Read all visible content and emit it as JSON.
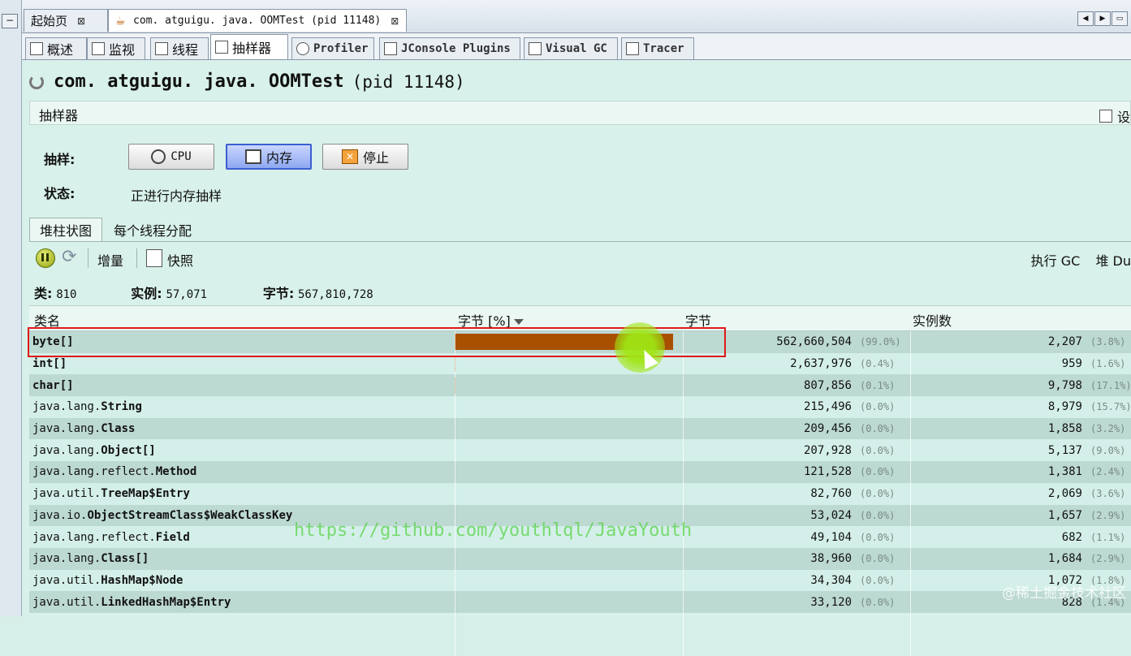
{
  "doc_tabs": [
    {
      "label": "起始页",
      "close": "⊠"
    },
    {
      "label": "com. atguigu. java. OOMTest  (pid 11148)",
      "close": "⊠"
    }
  ],
  "view_tabs": [
    "概述",
    "监视",
    "线程",
    "抽样器",
    "Profiler",
    "JConsole Plugins",
    "Visual GC",
    "Tracer"
  ],
  "app": {
    "title": "com. atguigu. java. OOMTest",
    "pid": "(pid 11148)"
  },
  "section": {
    "label": "抽样器",
    "settings": "设"
  },
  "sampler": {
    "sample_label": "抽样:",
    "cpu": "CPU",
    "memory": "内存",
    "stop": "停止",
    "status_label": "状态:",
    "status_value": "正进行内存抽样"
  },
  "sub_tabs": [
    "堆柱状图",
    "每个线程分配"
  ],
  "toolbar": {
    "delta": "增量",
    "snapshot": "快照",
    "gc": "执行 GC",
    "heap_dump": "堆 Du"
  },
  "summary": {
    "classes_label": "类:",
    "classes": "810",
    "instances_label": "实例:",
    "instances": "57,071",
    "bytes_label": "字节:",
    "bytes": "567,810,728"
  },
  "columns": {
    "name": "类名",
    "bytes_pct": "字节 [%]",
    "bytes": "字节",
    "instances": "实例数"
  },
  "rows": [
    {
      "name_plain": "",
      "name_bold": "byte[]",
      "bytes": "562,660,504",
      "bytes_pct": "(99.0%)",
      "instances": "2,207",
      "inst_pct": "(3.8%)",
      "fraction": 0.99
    },
    {
      "name_plain": "",
      "name_bold": "int[]",
      "bytes": "2,637,976",
      "bytes_pct": "(0.4%)",
      "instances": "959",
      "inst_pct": "(1.6%)",
      "fraction": 0.004
    },
    {
      "name_plain": "",
      "name_bold": "char[]",
      "bytes": "807,856",
      "bytes_pct": "(0.1%)",
      "instances": "9,798",
      "inst_pct": "(17.1%)",
      "fraction": 0.001
    },
    {
      "name_plain": "java.lang.",
      "name_bold": "String",
      "bytes": "215,496",
      "bytes_pct": "(0.0%)",
      "instances": "8,979",
      "inst_pct": "(15.7%)",
      "fraction": 0
    },
    {
      "name_plain": "java.lang.",
      "name_bold": "Class",
      "bytes": "209,456",
      "bytes_pct": "(0.0%)",
      "instances": "1,858",
      "inst_pct": "(3.2%)",
      "fraction": 0
    },
    {
      "name_plain": "java.lang.",
      "name_bold": "Object[]",
      "bytes": "207,928",
      "bytes_pct": "(0.0%)",
      "instances": "5,137",
      "inst_pct": "(9.0%)",
      "fraction": 0
    },
    {
      "name_plain": "java.lang.reflect.",
      "name_bold": "Method",
      "bytes": "121,528",
      "bytes_pct": "(0.0%)",
      "instances": "1,381",
      "inst_pct": "(2.4%)",
      "fraction": 0
    },
    {
      "name_plain": "java.util.",
      "name_bold": "TreeMap$Entry",
      "bytes": "82,760",
      "bytes_pct": "(0.0%)",
      "instances": "2,069",
      "inst_pct": "(3.6%)",
      "fraction": 0
    },
    {
      "name_plain": "java.io.",
      "name_bold": "ObjectStreamClass$WeakClassKey",
      "bytes": "53,024",
      "bytes_pct": "(0.0%)",
      "instances": "1,657",
      "inst_pct": "(2.9%)",
      "fraction": 0
    },
    {
      "name_plain": "java.lang.reflect.",
      "name_bold": "Field",
      "bytes": "49,104",
      "bytes_pct": "(0.0%)",
      "instances": "682",
      "inst_pct": "(1.1%)",
      "fraction": 0
    },
    {
      "name_plain": "java.lang.",
      "name_bold": "Class[]",
      "bytes": "38,960",
      "bytes_pct": "(0.0%)",
      "instances": "1,684",
      "inst_pct": "(2.9%)",
      "fraction": 0
    },
    {
      "name_plain": "java.util.",
      "name_bold": "HashMap$Node",
      "bytes": "34,304",
      "bytes_pct": "(0.0%)",
      "instances": "1,072",
      "inst_pct": "(1.8%)",
      "fraction": 0
    },
    {
      "name_plain": "java.util.",
      "name_bold": "LinkedHashMap$Entry",
      "bytes": "33,120",
      "bytes_pct": "(0.0%)",
      "instances": "828",
      "inst_pct": "(1.4%)",
      "fraction": 0
    }
  ],
  "overlay": {
    "watermark": "https://github.com/youthlql/JavaYouth",
    "corner": "@稀土掘金技术社区"
  },
  "colors": {
    "bar": "#a85000",
    "highlight": "#e01818"
  }
}
